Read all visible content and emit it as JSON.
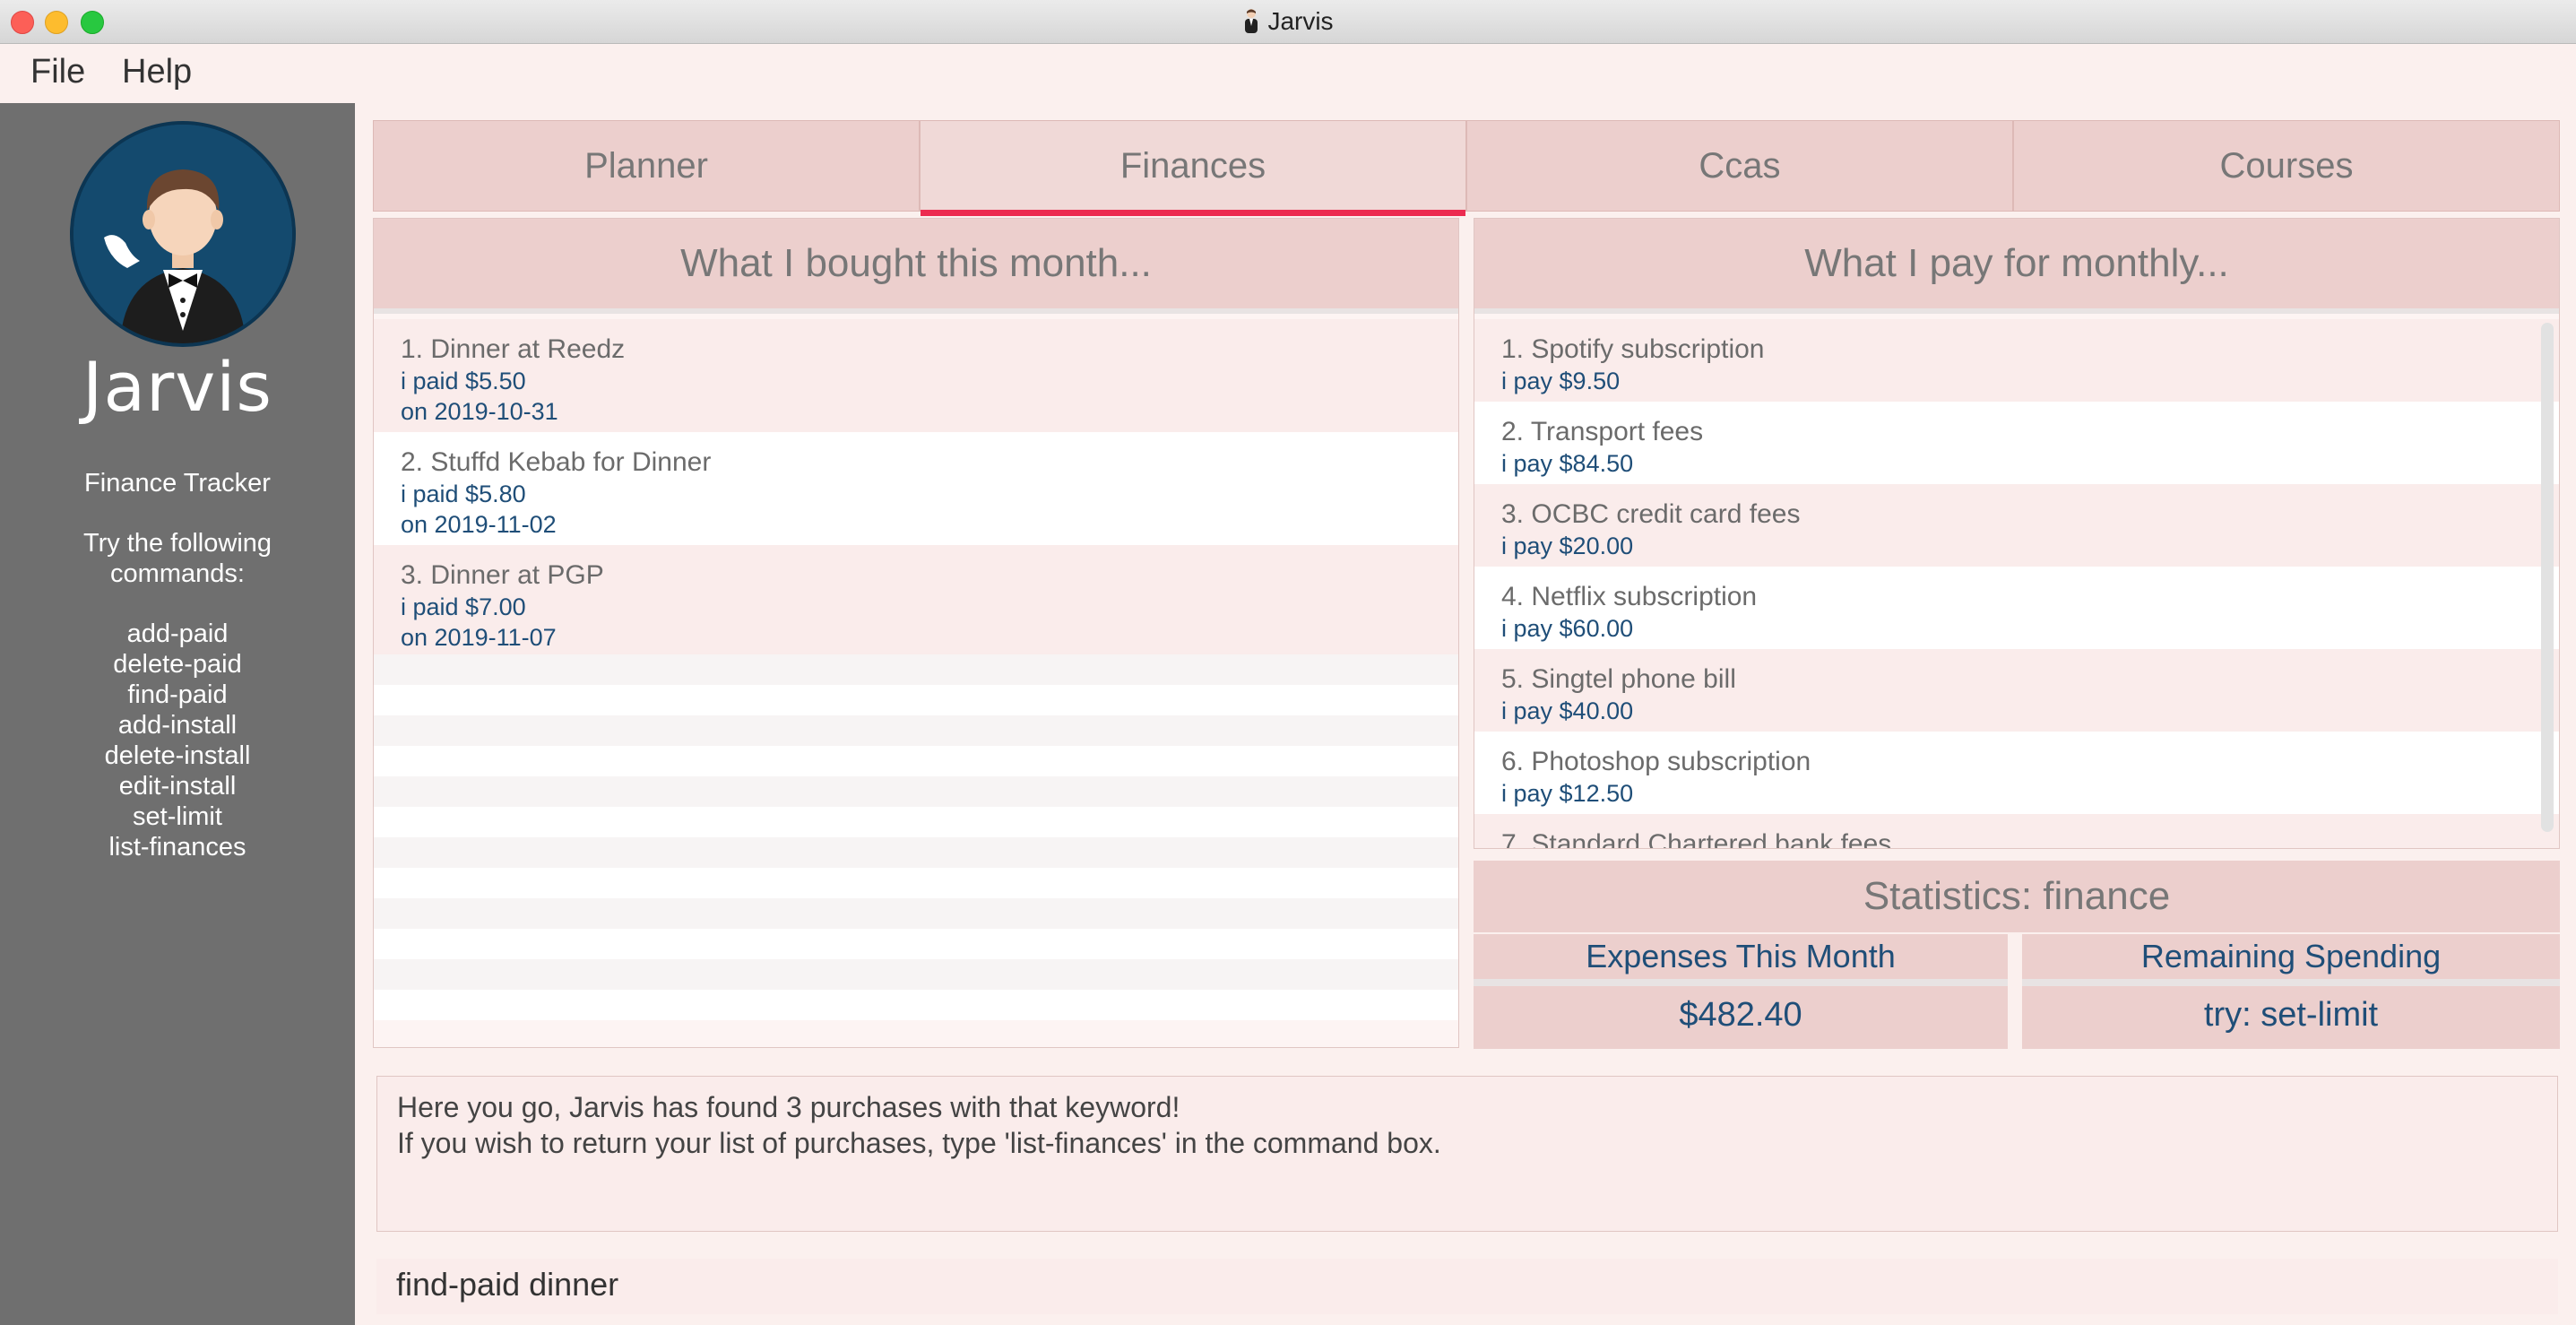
{
  "window": {
    "title": "Jarvis"
  },
  "menu": {
    "file": "File",
    "help": "Help"
  },
  "sidebar": {
    "app_name": "Jarvis",
    "section": "Finance Tracker",
    "hint": "Try the following commands:",
    "commands": [
      "add-paid",
      "delete-paid",
      "find-paid",
      "add-install",
      "delete-install",
      "edit-install",
      "set-limit",
      "list-finances"
    ]
  },
  "tabs": [
    {
      "label": "Planner",
      "active": false
    },
    {
      "label": "Finances",
      "active": true
    },
    {
      "label": "Ccas",
      "active": false
    },
    {
      "label": "Courses",
      "active": false
    }
  ],
  "purchases": {
    "header": "What I bought this month...",
    "items": [
      {
        "title": "1. Dinner at Reedz",
        "paid": "i paid $5.50",
        "date": "on 2019-10-31"
      },
      {
        "title": "2. Stuffd Kebab for Dinner",
        "paid": "i paid $5.80",
        "date": "on 2019-11-02"
      },
      {
        "title": "3. Dinner at PGP",
        "paid": "i paid $7.00",
        "date": "on 2019-11-07"
      }
    ]
  },
  "installments": {
    "header": "What I pay for monthly...",
    "items": [
      {
        "title": "1. Spotify subscription",
        "pay": "i pay $9.50"
      },
      {
        "title": "2. Transport fees",
        "pay": "i pay $84.50"
      },
      {
        "title": "3. OCBC credit card fees",
        "pay": "i pay $20.00"
      },
      {
        "title": "4. Netflix subscription",
        "pay": "i pay $60.00"
      },
      {
        "title": "5. Singtel phone bill",
        "pay": "i pay $40.00"
      },
      {
        "title": "6. Photoshop subscription",
        "pay": "i pay $12.50"
      },
      {
        "title": "7. Standard Chartered bank fees",
        "pay": ""
      }
    ]
  },
  "statistics": {
    "header": "Statistics: finance",
    "expenses_label": "Expenses This Month",
    "expenses_value": "$482.40",
    "remaining_label": "Remaining Spending",
    "remaining_value": "try: set-limit"
  },
  "result": {
    "line1": "Here you go, Jarvis has found 3 purchases with that keyword!",
    "line2": "If you wish to return your list of purchases, type 'list-finances' in the command box."
  },
  "command_box": {
    "value": "find-paid dinner"
  },
  "colors": {
    "accent": "#ec2b50",
    "value_text": "#1f4e78",
    "sidebar_bg": "#6f6f6f",
    "panel_bg": "#eccfcd"
  }
}
